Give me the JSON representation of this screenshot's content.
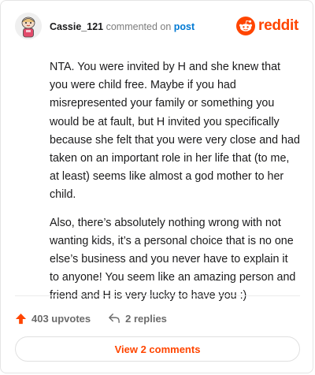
{
  "comment": {
    "username": "Cassie_121",
    "action_text": "commented on",
    "post_link": "post",
    "paragraphs": [
      "NTA. You were invited by H and she knew that you were child free. Maybe if you had misrepresented your family or something you would be at fault, but H invited you specifically because she felt that you were very close and had taken on an important role in her life that (to me, at least) seems like almost a god mother to her child.",
      "Also, there’s absolutely nothing wrong with not wanting kids, it’s a personal choice that is no one else’s business and you never have to explain it to anyone! You seem like an amazing person and friend and H is very lucky to have you :)"
    ],
    "upvotes_label": "403 upvotes",
    "replies_label": "2 replies",
    "view_comments_label": "View 2 comments"
  },
  "brand": {
    "wordmark": "reddit",
    "accent": "#ff4500",
    "link_color": "#0079d3"
  },
  "icons": {
    "avatar": "avatar-icon",
    "logo": "reddit-logo-icon",
    "upvote": "upvote-arrow-icon",
    "reply": "reply-arrow-icon"
  }
}
